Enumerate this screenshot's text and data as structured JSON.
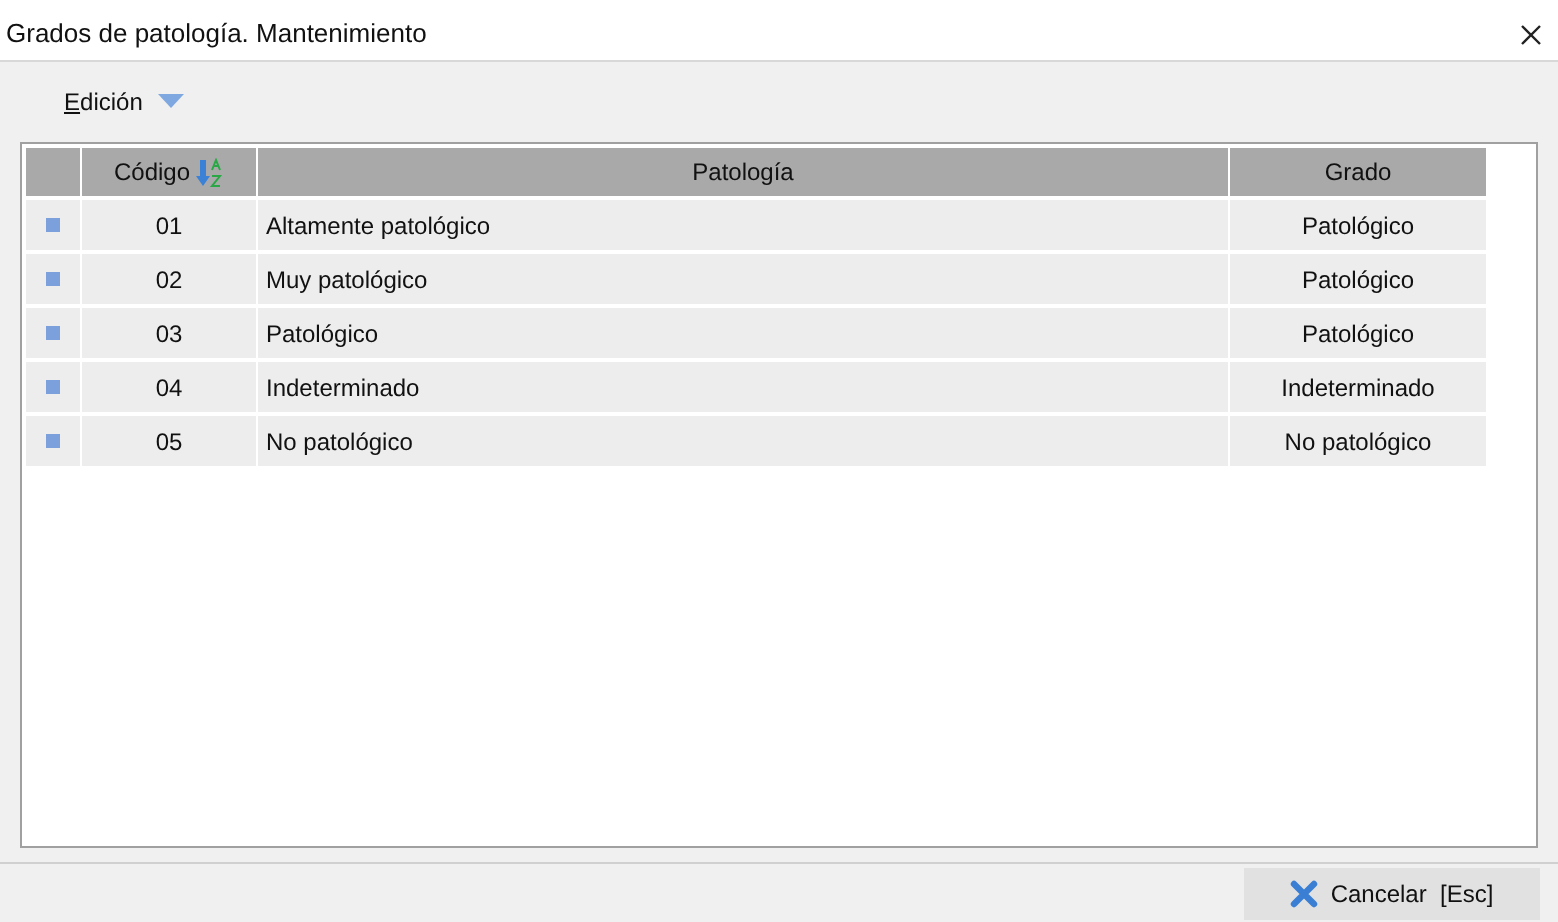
{
  "window": {
    "title": "Grados de patología. Mantenimiento"
  },
  "toolbar": {
    "menu": "Edición"
  },
  "table": {
    "columns": [
      "Código",
      "Patología",
      "Grado"
    ],
    "rows": [
      {
        "code": "01",
        "pathology": "Altamente patológico",
        "grade": "Patológico"
      },
      {
        "code": "02",
        "pathology": "Muy patológico",
        "grade": "Patológico"
      },
      {
        "code": "03",
        "pathology": "Patológico",
        "grade": "Patológico"
      },
      {
        "code": "04",
        "pathology": "Indeterminado",
        "grade": "Indeterminado"
      },
      {
        "code": "05",
        "pathology": "No patológico",
        "grade": "No patológico"
      }
    ]
  },
  "buttons": [
    {
      "label": "Cancelar  [Esc]"
    }
  ]
}
